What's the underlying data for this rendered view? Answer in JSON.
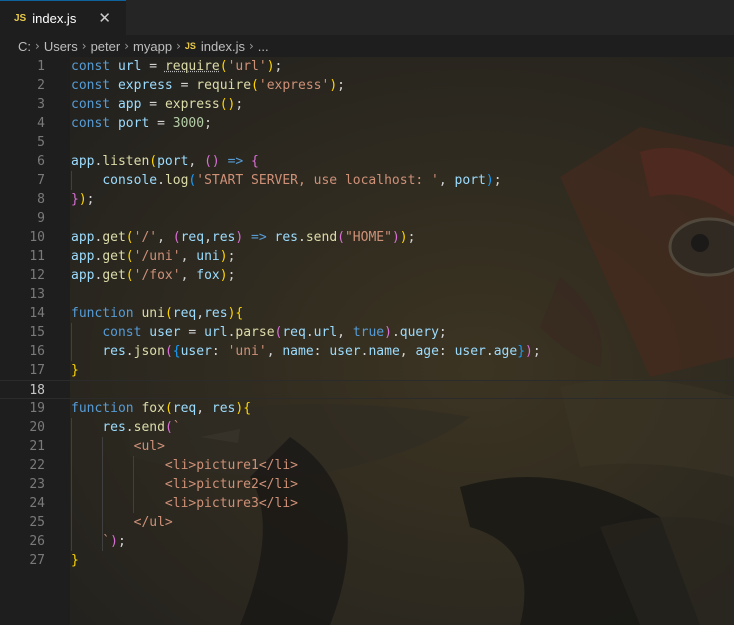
{
  "tab": {
    "icon": "JS",
    "name": "index.js",
    "close": "✕"
  },
  "breadcrumb": {
    "drive": "C:",
    "parts": [
      "Users",
      "peter",
      "myapp"
    ],
    "file_icon": "JS",
    "file": "index.js",
    "more": "..."
  },
  "editor": {
    "active_line": 18,
    "lines": [
      [
        [
          "kw",
          "const"
        ],
        [
          "pn",
          " "
        ],
        [
          "var",
          "url"
        ],
        [
          "pn",
          " = "
        ],
        [
          "fn",
          "require"
        ],
        [
          "br1",
          "("
        ],
        [
          "str",
          "'url'"
        ],
        [
          "br1",
          ")"
        ],
        [
          "pn",
          ";"
        ]
      ],
      [
        [
          "kw",
          "const"
        ],
        [
          "pn",
          " "
        ],
        [
          "var",
          "express"
        ],
        [
          "pn",
          " = "
        ],
        [
          "fn",
          "require"
        ],
        [
          "br1",
          "("
        ],
        [
          "str",
          "'express'"
        ],
        [
          "br1",
          ")"
        ],
        [
          "pn",
          ";"
        ]
      ],
      [
        [
          "kw",
          "const"
        ],
        [
          "pn",
          " "
        ],
        [
          "var",
          "app"
        ],
        [
          "pn",
          " = "
        ],
        [
          "fn",
          "express"
        ],
        [
          "br1",
          "()"
        ],
        [
          "pn",
          ";"
        ]
      ],
      [
        [
          "kw",
          "const"
        ],
        [
          "pn",
          " "
        ],
        [
          "var",
          "port"
        ],
        [
          "pn",
          " = "
        ],
        [
          "num",
          "3000"
        ],
        [
          "pn",
          ";"
        ]
      ],
      [],
      [
        [
          "var",
          "app"
        ],
        [
          "pn",
          "."
        ],
        [
          "fn",
          "listen"
        ],
        [
          "br1",
          "("
        ],
        [
          "var",
          "port"
        ],
        [
          "pn",
          ", "
        ],
        [
          "br2",
          "()"
        ],
        [
          "pn",
          " "
        ],
        [
          "kw",
          "=>"
        ],
        [
          "pn",
          " "
        ],
        [
          "br2",
          "{"
        ]
      ],
      [
        [
          "pn",
          "    "
        ],
        [
          "var",
          "console"
        ],
        [
          "pn",
          "."
        ],
        [
          "fn",
          "log"
        ],
        [
          "br3",
          "("
        ],
        [
          "str",
          "'START SERVER, use localhost: '"
        ],
        [
          "pn",
          ", "
        ],
        [
          "var",
          "port"
        ],
        [
          "br3",
          ")"
        ],
        [
          "pn",
          ";"
        ]
      ],
      [
        [
          "br2",
          "}"
        ],
        [
          "br1",
          ")"
        ],
        [
          "pn",
          ";"
        ]
      ],
      [],
      [
        [
          "var",
          "app"
        ],
        [
          "pn",
          "."
        ],
        [
          "fn",
          "get"
        ],
        [
          "br1",
          "("
        ],
        [
          "str",
          "'/'"
        ],
        [
          "pn",
          ", "
        ],
        [
          "br2",
          "("
        ],
        [
          "var",
          "req"
        ],
        [
          "pn",
          ","
        ],
        [
          "var",
          "res"
        ],
        [
          "br2",
          ")"
        ],
        [
          "pn",
          " "
        ],
        [
          "kw",
          "=>"
        ],
        [
          "pn",
          " "
        ],
        [
          "var",
          "res"
        ],
        [
          "pn",
          "."
        ],
        [
          "fn",
          "send"
        ],
        [
          "br2",
          "("
        ],
        [
          "str",
          "\"HOME\""
        ],
        [
          "br2",
          ")"
        ],
        [
          "br1",
          ")"
        ],
        [
          "pn",
          ";"
        ]
      ],
      [
        [
          "var",
          "app"
        ],
        [
          "pn",
          "."
        ],
        [
          "fn",
          "get"
        ],
        [
          "br1",
          "("
        ],
        [
          "str",
          "'/uni'"
        ],
        [
          "pn",
          ", "
        ],
        [
          "var",
          "uni"
        ],
        [
          "br1",
          ")"
        ],
        [
          "pn",
          ";"
        ]
      ],
      [
        [
          "var",
          "app"
        ],
        [
          "pn",
          "."
        ],
        [
          "fn",
          "get"
        ],
        [
          "br1",
          "("
        ],
        [
          "str",
          "'/fox'"
        ],
        [
          "pn",
          ", "
        ],
        [
          "var",
          "fox"
        ],
        [
          "br1",
          ")"
        ],
        [
          "pn",
          ";"
        ]
      ],
      [],
      [
        [
          "kw",
          "function"
        ],
        [
          "pn",
          " "
        ],
        [
          "fn",
          "uni"
        ],
        [
          "br1",
          "("
        ],
        [
          "var",
          "req"
        ],
        [
          "pn",
          ","
        ],
        [
          "var",
          "res"
        ],
        [
          "br1",
          ")"
        ],
        [
          "br1",
          "{"
        ]
      ],
      [
        [
          "pn",
          "    "
        ],
        [
          "kw",
          "const"
        ],
        [
          "pn",
          " "
        ],
        [
          "var",
          "user"
        ],
        [
          "pn",
          " = "
        ],
        [
          "var",
          "url"
        ],
        [
          "pn",
          "."
        ],
        [
          "fn",
          "parse"
        ],
        [
          "br2",
          "("
        ],
        [
          "var",
          "req"
        ],
        [
          "pn",
          "."
        ],
        [
          "var",
          "url"
        ],
        [
          "pn",
          ", "
        ],
        [
          "kw",
          "true"
        ],
        [
          "br2",
          ")"
        ],
        [
          "pn",
          "."
        ],
        [
          "var",
          "query"
        ],
        [
          "pn",
          ";"
        ]
      ],
      [
        [
          "pn",
          "    "
        ],
        [
          "var",
          "res"
        ],
        [
          "pn",
          "."
        ],
        [
          "fn",
          "json"
        ],
        [
          "br2",
          "("
        ],
        [
          "br3",
          "{"
        ],
        [
          "var",
          "user"
        ],
        [
          "pn",
          ": "
        ],
        [
          "str",
          "'uni'"
        ],
        [
          "pn",
          ", "
        ],
        [
          "var",
          "name"
        ],
        [
          "pn",
          ": "
        ],
        [
          "var",
          "user"
        ],
        [
          "pn",
          "."
        ],
        [
          "var",
          "name"
        ],
        [
          "pn",
          ", "
        ],
        [
          "var",
          "age"
        ],
        [
          "pn",
          ": "
        ],
        [
          "var",
          "user"
        ],
        [
          "pn",
          "."
        ],
        [
          "var",
          "age"
        ],
        [
          "br3",
          "}"
        ],
        [
          "br2",
          ")"
        ],
        [
          "pn",
          ";"
        ]
      ],
      [
        [
          "br1",
          "}"
        ]
      ],
      [],
      [
        [
          "kw",
          "function"
        ],
        [
          "pn",
          " "
        ],
        [
          "fn",
          "fox"
        ],
        [
          "br1",
          "("
        ],
        [
          "var",
          "req"
        ],
        [
          "pn",
          ", "
        ],
        [
          "var",
          "res"
        ],
        [
          "br1",
          ")"
        ],
        [
          "br1",
          "{"
        ]
      ],
      [
        [
          "pn",
          "    "
        ],
        [
          "var",
          "res"
        ],
        [
          "pn",
          "."
        ],
        [
          "fn",
          "send"
        ],
        [
          "br2",
          "("
        ],
        [
          "str",
          "`"
        ]
      ],
      [
        [
          "str",
          "        <ul>"
        ]
      ],
      [
        [
          "str",
          "            <li>picture1</li>"
        ]
      ],
      [
        [
          "str",
          "            <li>picture2</li>"
        ]
      ],
      [
        [
          "str",
          "            <li>picture3</li>"
        ]
      ],
      [
        [
          "str",
          "        </ul>"
        ]
      ],
      [
        [
          "str",
          "    `"
        ],
        [
          "br2",
          ")"
        ],
        [
          "pn",
          ";"
        ]
      ],
      [
        [
          "br1",
          "}"
        ]
      ]
    ]
  }
}
